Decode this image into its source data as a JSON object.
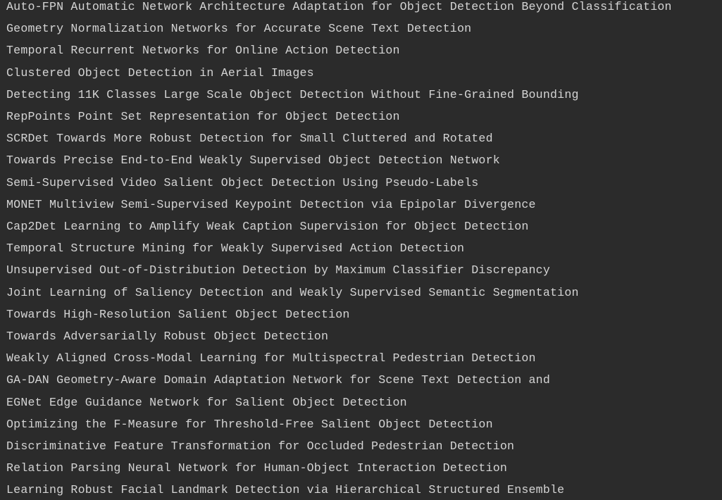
{
  "console": {
    "background": "#2b2b2b",
    "text_color": "#d4d4d4",
    "lines": [
      "Auto-FPN Automatic Network Architecture Adaptation for Object Detection Beyond Classification",
      "Geometry Normalization Networks for Accurate Scene Text Detection",
      "Temporal Recurrent Networks for Online Action Detection",
      "Clustered Object Detection in Aerial Images",
      "Detecting 11K Classes Large Scale Object Detection Without Fine-Grained Bounding",
      "RepPoints Point Set Representation for Object Detection",
      "SCRDet Towards More Robust Detection for Small Cluttered and Rotated",
      "Towards Precise End-to-End Weakly Supervised Object Detection Network",
      "Semi-Supervised Video Salient Object Detection Using Pseudo-Labels",
      "MONET Multiview Semi-Supervised Keypoint Detection via Epipolar Divergence",
      "Cap2Det Learning to Amplify Weak Caption Supervision for Object Detection",
      "Temporal Structure Mining for Weakly Supervised Action Detection",
      "Unsupervised Out-of-Distribution Detection by Maximum Classifier Discrepancy",
      "Joint Learning of Saliency Detection and Weakly Supervised Semantic Segmentation",
      "Towards High-Resolution Salient Object Detection",
      "Towards Adversarially Robust Object Detection",
      "Weakly Aligned Cross-Modal Learning for Multispectral Pedestrian Detection",
      "GA-DAN Geometry-Aware Domain Adaptation Network for Scene Text Detection and",
      "EGNet Edge Guidance Network for Salient Object Detection",
      "Optimizing the F-Measure for Threshold-Free Salient Object Detection",
      "Discriminative Feature Transformation for Occluded Pedestrian Detection",
      "Relation Parsing Neural Network for Human-Object Interaction Detection",
      "Learning Robust Facial Landmark Detection via Hierarchical Structured Ensemble"
    ]
  }
}
